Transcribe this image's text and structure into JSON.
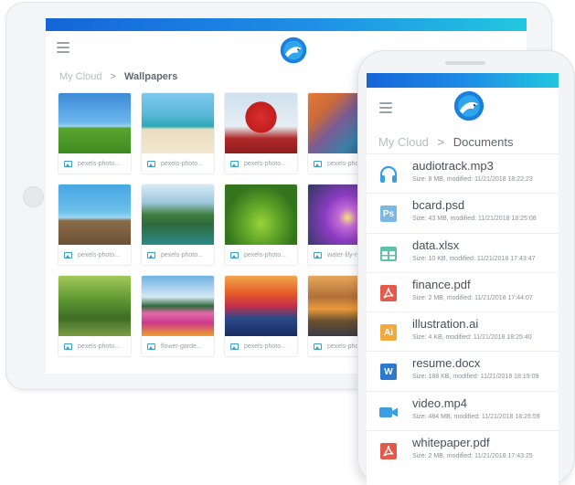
{
  "tablet": {
    "breadcrumb": {
      "root": "My Cloud",
      "separator": ">",
      "current": "Wallpapers"
    },
    "tiles": [
      {
        "caption": "pexels-photo..."
      },
      {
        "caption": "pexels-photo..."
      },
      {
        "caption": "pexels-photo..."
      },
      {
        "caption": "pexels-photo..."
      },
      {
        "caption": "pexels-photo..."
      },
      {
        "caption": "pexels-photo..."
      },
      {
        "caption": "pexels-photo..."
      },
      {
        "caption": "water-lily-no..."
      },
      {
        "caption": "pexels-photo..."
      },
      {
        "caption": "flower-garde..."
      },
      {
        "caption": "pexels-photo..."
      },
      {
        "caption": "pexels-photo..."
      }
    ]
  },
  "phone": {
    "breadcrumb": {
      "root": "My Cloud",
      "separator": ">",
      "current": "Documents"
    },
    "files": [
      {
        "name": "audiotrack.mp3",
        "meta": "Size: 8 MB, modified: 11/21/2018 18:22:23",
        "icon": "headphones-icon"
      },
      {
        "name": "bcard.psd",
        "meta": "Size: 43 MB, modified: 11/21/2018 18:25:08",
        "icon": "photoshop-file-icon",
        "badge": "Ps"
      },
      {
        "name": "data.xlsx",
        "meta": "Size: 10 KB, modified: 11/21/2018 17:43:47",
        "icon": "spreadsheet-icon"
      },
      {
        "name": "finance.pdf",
        "meta": "Size: 2 MB, modified: 11/21/2018 17:44:07",
        "icon": "pdf-icon"
      },
      {
        "name": "illustration.ai",
        "meta": "Size: 4 KB, modified: 11/21/2018 18:25:40",
        "icon": "illustrator-file-icon",
        "badge": "Ai"
      },
      {
        "name": "resume.docx",
        "meta": "Size: 188 KB, modified: 11/21/2018 18:19:09",
        "icon": "word-file-icon",
        "badge": "W"
      },
      {
        "name": "video.mp4",
        "meta": "Size: 484 MB, modified: 11/21/2018 18:26:59",
        "icon": "video-camera-icon"
      },
      {
        "name": "whitepaper.pdf",
        "meta": "Size: 2 MB, modified: 11/21/2018 17:43:25",
        "icon": "pdf-icon"
      }
    ]
  },
  "colors": {
    "accent_start": "#1565d8",
    "accent_end": "#22c7e0",
    "audio": "#3a9ee0",
    "photoshop": "#6fb6e8",
    "spreadsheet": "#5fc2a6",
    "pdf": "#e45a4a",
    "illustrator": "#f2a93b",
    "word": "#2f78cf",
    "video": "#3a9ee0"
  }
}
